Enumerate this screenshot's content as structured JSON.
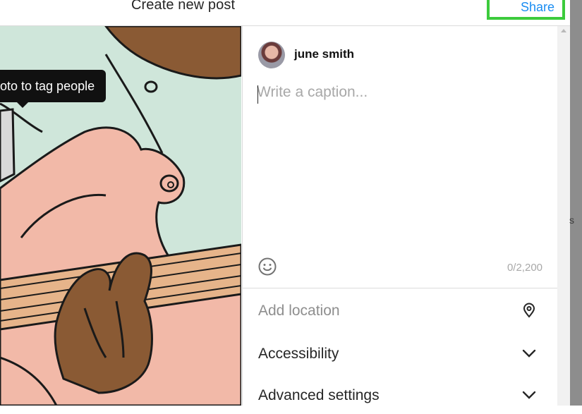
{
  "header": {
    "title": "Create new post",
    "share_label": "Share"
  },
  "photo": {
    "tooltip": "oto to tag people"
  },
  "panel": {
    "username": "june smith",
    "caption_placeholder": "Write a caption...",
    "caption_value": "",
    "char_count": "0/2,200",
    "rows": [
      {
        "label": "Add location",
        "icon": "location-pin-icon"
      },
      {
        "label": "Accessibility",
        "icon": "chevron-down-icon"
      },
      {
        "label": "Advanced settings",
        "icon": "chevron-down-icon"
      }
    ]
  },
  "backdrop": {
    "fragment_1": "s"
  },
  "colors": {
    "accent": "#1a8df2",
    "highlight_border": "#3ccb3c",
    "placeholder": "#a8a8a8"
  }
}
